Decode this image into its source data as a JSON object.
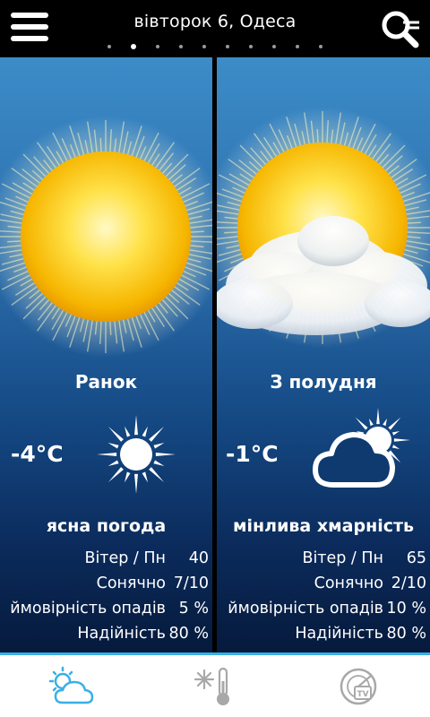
{
  "header": {
    "title": "вівторок 6, Одеса",
    "page_count": 10,
    "active_page": 1
  },
  "panels": [
    {
      "period": "Ранок",
      "temp": "-4°C",
      "icon": "sun-icon",
      "description": "ясна погода",
      "rows": [
        {
          "label": "Вітер / Пн",
          "value": "40"
        },
        {
          "label": "Сонячно",
          "value": "7/10"
        },
        {
          "label": "ймовірність опадів",
          "value": "5 %"
        },
        {
          "label": "Надійність",
          "value": "80 %"
        }
      ]
    },
    {
      "period": "З полудня",
      "temp": "-1°C",
      "icon": "partly-cloudy-icon",
      "description": "мінлива хмарність",
      "rows": [
        {
          "label": "Вітер / Пн",
          "value": "65"
        },
        {
          "label": "Сонячно",
          "value": "2/10"
        },
        {
          "label": "ймовірність опадів",
          "value": "10 %"
        },
        {
          "label": "Надійність",
          "value": "80 %"
        }
      ]
    }
  ],
  "tabs": [
    {
      "icon": "weather-cloud-sun-icon",
      "active": true
    },
    {
      "icon": "snow-thermometer-icon",
      "active": false
    },
    {
      "icon": "radar-tv-icon",
      "active": false
    }
  ],
  "colors": {
    "accent": "#39b0e6",
    "panel_top": "#3c8cc8",
    "panel_bottom": "#061a3c"
  }
}
